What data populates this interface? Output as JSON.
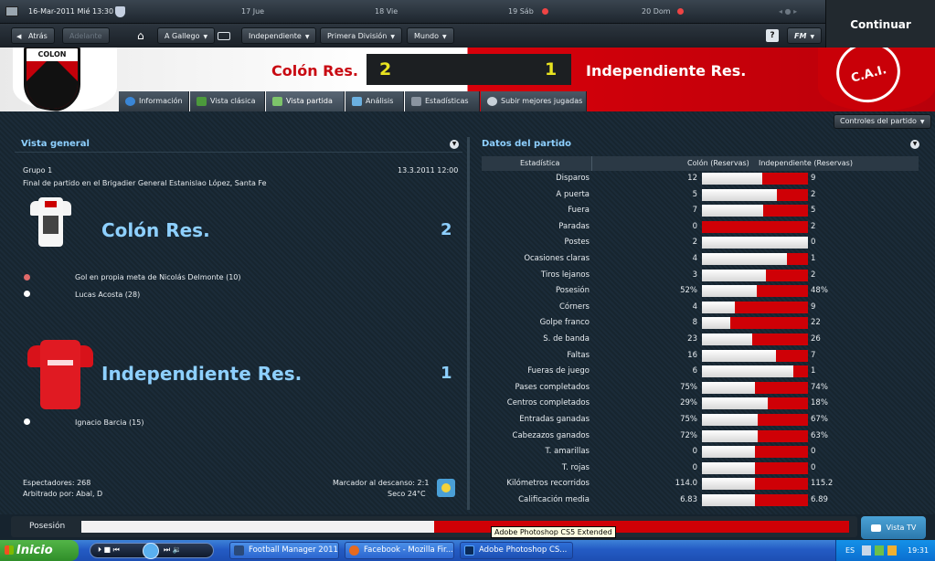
{
  "topbar": {
    "date": "16-Mar-2011 Mié 13:30",
    "days": [
      "17 Jue",
      "18 Vie",
      "19 Sáb",
      "20 Dom"
    ]
  },
  "nav": {
    "back": "Atrás",
    "forward": "Adelante",
    "menus": [
      "A Gallego",
      "Independiente",
      "Primera División",
      "Mundo"
    ],
    "help": "?",
    "fm": "FM",
    "continue": "Continuar"
  },
  "match": {
    "home_team": "Colón Res.",
    "away_team": "Independiente Res.",
    "home_score": "2",
    "away_score": "1",
    "home_crest_text": "COLON",
    "away_crest_text": "C.A.I."
  },
  "tabs": [
    "Información",
    "Vista clásica",
    "Vista partida",
    "Análisis",
    "Estadísticas",
    "Subir mejores jugadas"
  ],
  "controls_label": "Controles del partido",
  "overview": {
    "title": "Vista general",
    "group": "Grupo 1",
    "date": "13.3.2011 12:00",
    "venue": "Final de partido en el Brigadier General Estanislao López, Santa Fe",
    "home_team": "Colón Res.",
    "home_score": "2",
    "home_events": [
      "Gol en propia meta de Nicolás Delmonte (10)",
      "Lucas Acosta (28)"
    ],
    "away_team": "Independiente Res.",
    "away_score": "1",
    "away_events": [
      "Ignacio Barcia (15)"
    ],
    "attendance": "Espectadores: 268",
    "referee": "Arbitrado por: Abal, D",
    "halftime": "Marcador al descanso: 2:1",
    "weather": "Seco 24°C"
  },
  "stats": {
    "title": "Datos del partido",
    "col_stat": "Estadística",
    "col_home": "Colón (Reservas)",
    "col_away": "Independiente (Reservas)",
    "rows": [
      {
        "label": "Disparos",
        "home": "12",
        "away": "9",
        "share": 0.57
      },
      {
        "label": "A puerta",
        "home": "5",
        "away": "2",
        "share": 0.71
      },
      {
        "label": "Fuera",
        "home": "7",
        "away": "5",
        "share": 0.58
      },
      {
        "label": "Paradas",
        "home": "0",
        "away": "2",
        "share": 0.0
      },
      {
        "label": "Postes",
        "home": "2",
        "away": "0",
        "share": 1.0
      },
      {
        "label": "Ocasiones claras",
        "home": "4",
        "away": "1",
        "share": 0.8
      },
      {
        "label": "Tiros lejanos",
        "home": "3",
        "away": "2",
        "share": 0.6
      },
      {
        "label": "Posesión",
        "home": "52%",
        "away": "48%",
        "share": 0.52
      },
      {
        "label": "Córners",
        "home": "4",
        "away": "9",
        "share": 0.31
      },
      {
        "label": "Golpe franco",
        "home": "8",
        "away": "22",
        "share": 0.27
      },
      {
        "label": "S. de banda",
        "home": "23",
        "away": "26",
        "share": 0.47
      },
      {
        "label": "Faltas",
        "home": "16",
        "away": "7",
        "share": 0.7
      },
      {
        "label": "Fueras de juego",
        "home": "6",
        "away": "1",
        "share": 0.86
      },
      {
        "label": "Pases completados",
        "home": "75%",
        "away": "74%",
        "share": 0.5
      },
      {
        "label": "Centros completados",
        "home": "29%",
        "away": "18%",
        "share": 0.62
      },
      {
        "label": "Entradas ganadas",
        "home": "75%",
        "away": "67%",
        "share": 0.53
      },
      {
        "label": "Cabezazos ganados",
        "home": "72%",
        "away": "63%",
        "share": 0.53
      },
      {
        "label": "T. amarillas",
        "home": "0",
        "away": "0",
        "share": 0.5
      },
      {
        "label": "T. rojas",
        "home": "0",
        "away": "0",
        "share": 0.5
      },
      {
        "label": "Kilómetros recorridos",
        "home": "114.0",
        "away": "115.2",
        "share": 0.5
      },
      {
        "label": "Calificación media",
        "home": "6.83",
        "away": "6.89",
        "share": 0.5
      }
    ]
  },
  "possession": {
    "label": "Posesión",
    "home_share": 0.46
  },
  "vista_tv": "Vista TV",
  "taskbar": {
    "start": "Inicio",
    "tasks": [
      "Football Manager 2011",
      "Facebook - Mozilla Fir...",
      "Adobe Photoshop CS..."
    ],
    "tooltip": "Adobe Photoshop CS5 Extended",
    "lang": "ES",
    "clock": "19:31"
  },
  "colors": {
    "home": "#ffffff",
    "away": "#cf0006",
    "accent": "#8ed0ff",
    "score": "#e8e320"
  }
}
